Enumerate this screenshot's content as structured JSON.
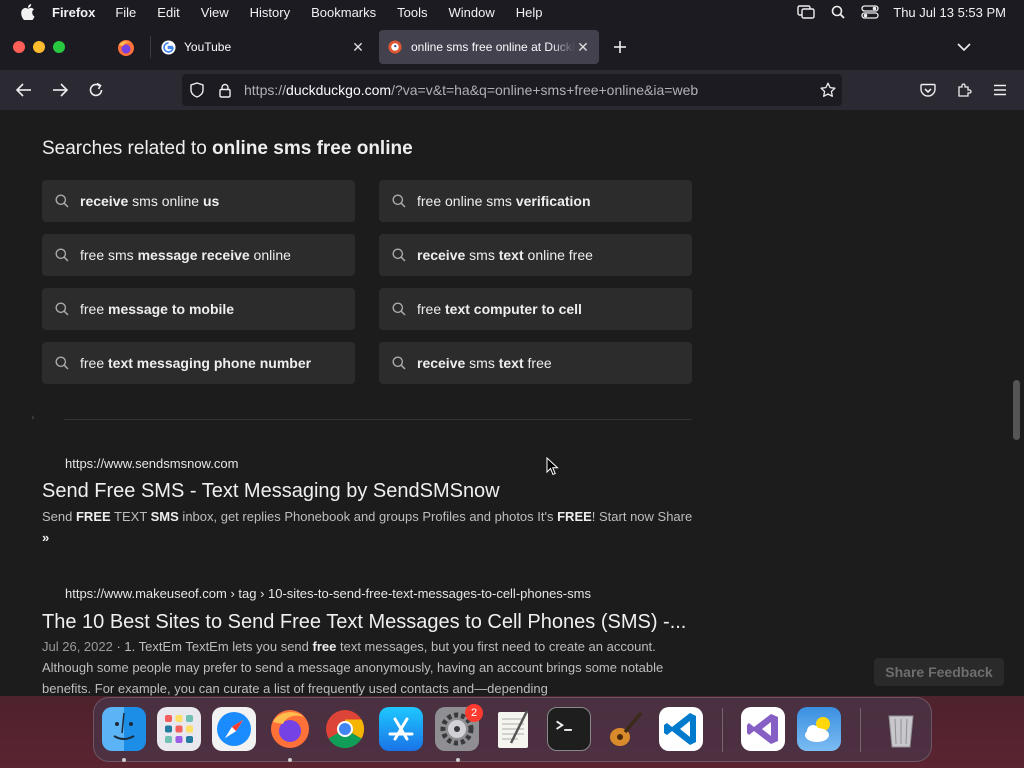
{
  "menubar": {
    "app_name": "Firefox",
    "items": [
      "File",
      "Edit",
      "View",
      "History",
      "Bookmarks",
      "Tools",
      "Window",
      "Help"
    ],
    "clock": "Thu Jul 13  5:53 PM"
  },
  "browser": {
    "tabs": [
      {
        "title": "YouTube",
        "favicon": "google-icon"
      },
      {
        "title": "online sms free online at DuckDuckGo",
        "favicon": "duckduckgo-icon",
        "active": true
      }
    ],
    "url_prefix": "https://",
    "url_domain": "duckduckgo.com",
    "url_rest": "/?va=v&t=ha&q=online+sms+free+online&ia=web"
  },
  "related": {
    "heading_prefix": "Searches related to ",
    "heading_query": "online sms free online",
    "chips": [
      {
        "bold1": "receive",
        "normal1": " sms online ",
        "bold2": "us",
        "normal2": ""
      },
      {
        "bold1": "",
        "normal1": "free online sms ",
        "bold2": "verification",
        "normal2": ""
      },
      {
        "bold1": "",
        "normal1": "free sms ",
        "bold2": "message receive",
        "normal2": " online"
      },
      {
        "bold1": "receive",
        "normal1": " sms ",
        "bold2": "text",
        "normal2": " online free"
      },
      {
        "bold1": "",
        "normal1": "free ",
        "bold2": "message to mobile",
        "normal2": ""
      },
      {
        "bold1": "",
        "normal1": "free ",
        "bold2": "text computer to cell",
        "normal2": ""
      },
      {
        "bold1": "",
        "normal1": "free ",
        "bold2": "text messaging phone number",
        "normal2": ""
      },
      {
        "bold1": "receive",
        "normal1": " sms ",
        "bold2": "text",
        "normal2": " free"
      }
    ]
  },
  "results": [
    {
      "url": "https://www.sendsmsnow.com",
      "title": "Send Free SMS - Text Messaging by SendSMSnow",
      "snippet_parts": [
        {
          "t": "Send ",
          "b": false
        },
        {
          "t": "FREE",
          "b": true
        },
        {
          "t": " TEXT ",
          "b": false
        },
        {
          "t": "SMS",
          "b": true
        },
        {
          "t": " inbox, get replies Phonebook and groups Profiles and photos It's ",
          "b": false
        },
        {
          "t": "FREE",
          "b": true
        },
        {
          "t": "! Start now Share ",
          "b": false
        },
        {
          "t": "»",
          "b": true
        }
      ]
    },
    {
      "url": "https://www.makeuseof.com › tag › 10-sites-to-send-free-text-messages-to-cell-phones-sms",
      "title": "The 10 Best Sites to Send Free Text Messages to Cell Phones (SMS) -...",
      "date": "Jul 26, 2022",
      "snippet_parts": [
        {
          "t": " · 1. TextEm TextEm lets you send ",
          "b": false
        },
        {
          "t": "free",
          "b": true
        },
        {
          "t": " text messages, but you first need to create an account. Although some people may prefer to send a message anonymously, having an account brings some notable benefits. For example, you can curate a list of frequently used contacts and—depending",
          "b": false
        }
      ]
    }
  ],
  "share_feedback": "Share Feedback",
  "dock": {
    "apps": [
      "Finder",
      "Launchpad",
      "Safari",
      "Firefox",
      "Google Chrome",
      "App Store",
      "System Settings",
      "TextEdit",
      "Terminal",
      "GarageBand",
      "Visual Studio Code",
      "Visual Studio",
      "Weather",
      "Trash"
    ],
    "settings_badge": "2"
  }
}
